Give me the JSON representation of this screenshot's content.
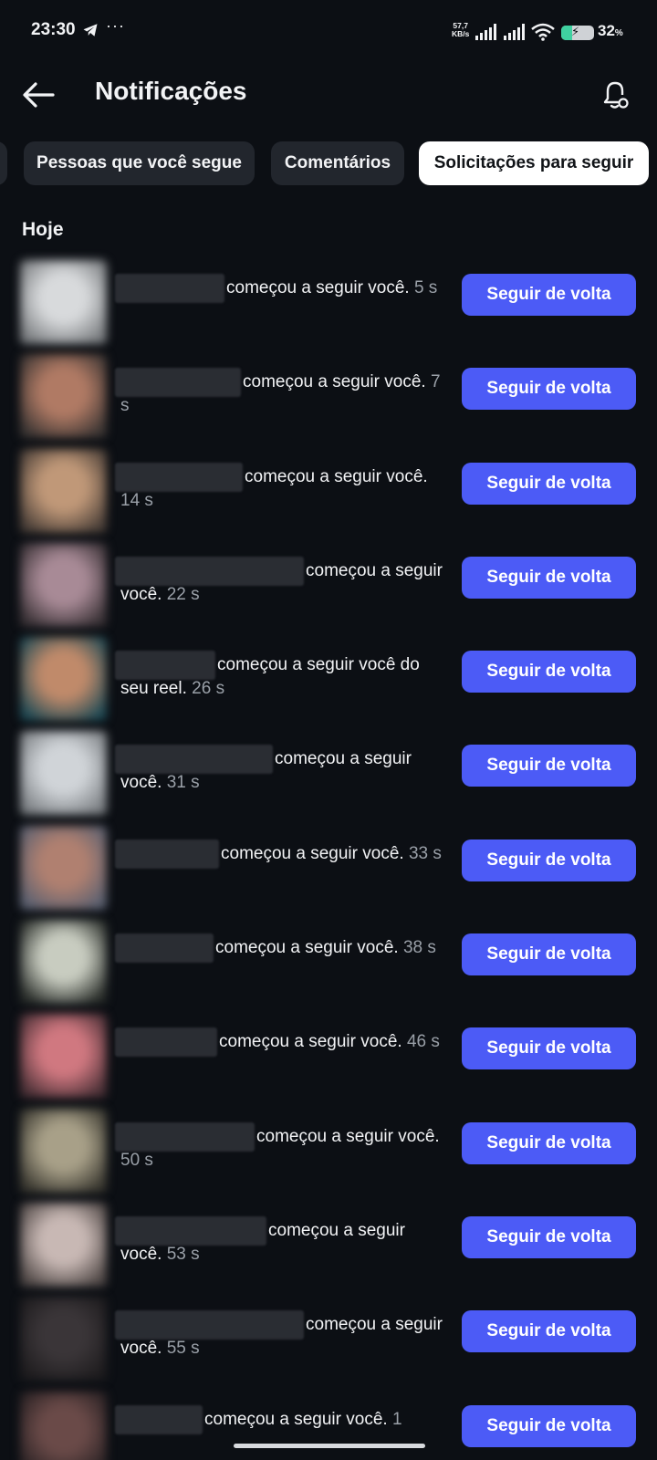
{
  "status_bar": {
    "time": "23:30",
    "more": "···",
    "speed_value": "57,7",
    "speed_unit": "KB/s",
    "battery_percent": "32",
    "battery_unit": "%",
    "battery_level": 0.32,
    "icons": [
      "telegram-icon",
      "signal-icon",
      "signal-icon",
      "wifi-icon",
      "battery-icon"
    ]
  },
  "header": {
    "title": "Notificações",
    "back_icon": "arrow-left-icon",
    "settings_icon": "bell-settings-icon"
  },
  "filters": [
    {
      "label": "Pessoas que você segue",
      "active": false
    },
    {
      "label": "Comentários",
      "active": false
    },
    {
      "label": "Solicitações para seguir",
      "active": true
    }
  ],
  "section": {
    "title": "Hoje"
  },
  "notifications": [
    {
      "text": "começou a seguir você.",
      "time": "5 s",
      "button": "Seguir de volta",
      "avatar_colors": [
        "#d8dadc",
        "#7a7d80"
      ]
    },
    {
      "text": "começou a seguir você.",
      "time": "7 s",
      "button": "Seguir de volta",
      "avatar_colors": [
        "#b07a64",
        "#3b3533"
      ]
    },
    {
      "text": "começou a seguir você.",
      "time": "14 s",
      "button": "Seguir de volta",
      "avatar_colors": [
        "#c09878",
        "#4a3f38"
      ]
    },
    {
      "text": "começou a seguir você.",
      "time": "22 s",
      "button": "Seguir de volta",
      "avatar_colors": [
        "#a88a96",
        "#3a3236"
      ]
    },
    {
      "text": "começou a seguir você do seu reel.",
      "time": "26 s",
      "button": "Seguir de volta",
      "avatar_colors": [
        "#c08a6a",
        "#1f4a55"
      ]
    },
    {
      "text": "começou a seguir você.",
      "time": "31 s",
      "button": "Seguir de volta",
      "avatar_colors": [
        "#d0d4d8",
        "#7c8084"
      ]
    },
    {
      "text": "começou a seguir você.",
      "time": "33 s",
      "button": "Seguir de volta",
      "avatar_colors": [
        "#b08070",
        "#5a6070"
      ]
    },
    {
      "text": "começou a seguir você.",
      "time": "38 s",
      "button": "Seguir de volta",
      "avatar_colors": [
        "#c8ccc0",
        "#2a2e2a"
      ]
    },
    {
      "text": "começou a seguir você.",
      "time": "46 s",
      "button": "Seguir de volta",
      "avatar_colors": [
        "#d07880",
        "#4a3036"
      ]
    },
    {
      "text": "começou a seguir você.",
      "time": "50 s",
      "button": "Seguir de volta",
      "avatar_colors": [
        "#a8a088",
        "#3a3830"
      ]
    },
    {
      "text": "começou a seguir você.",
      "time": "53 s",
      "button": "Seguir de volta",
      "avatar_colors": [
        "#c8b8b4",
        "#504846"
      ]
    },
    {
      "text": "começou a seguir você.",
      "time": "55 s",
      "button": "Seguir de volta",
      "avatar_colors": [
        "#3a3538",
        "#1e1c1e"
      ]
    },
    {
      "text": "começou a seguir você.",
      "time": "1",
      "button": "Seguir de volta",
      "avatar_colors": [
        "#6a4a48",
        "#2a2224"
      ]
    }
  ],
  "colors": {
    "background": "#0c0f14",
    "accent": "#4c5bf6",
    "chip": "#22262d",
    "chip_active": "#ffffff",
    "muted_text": "#9aa0a8"
  }
}
